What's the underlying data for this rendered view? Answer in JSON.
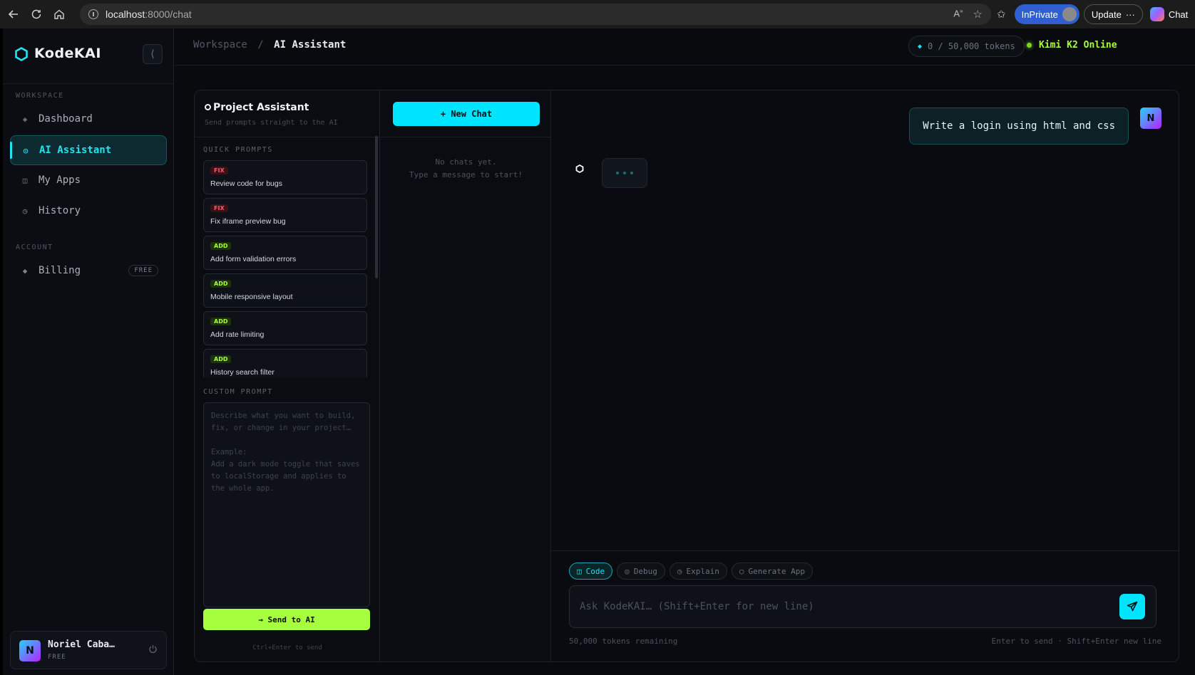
{
  "browser": {
    "url_host": "localhost",
    "url_path": ":8000/chat",
    "inprivate_label": "InPrivate",
    "update_label": "Update",
    "chat_label": "Chat"
  },
  "sidebar": {
    "brand": "KodeKAI",
    "collapse_glyph": "⟨",
    "workspace_label": "WORKSPACE",
    "account_label": "ACCOUNT",
    "items": [
      {
        "label": "Dashboard",
        "icon": "◈"
      },
      {
        "label": "AI Assistant",
        "icon": "◎"
      },
      {
        "label": "My Apps",
        "icon": "◫"
      },
      {
        "label": "History",
        "icon": "◷"
      }
    ],
    "billing": {
      "label": "Billing",
      "icon": "◆",
      "badge": "FREE"
    },
    "user": {
      "initial": "N",
      "name": "Noriel Caba…",
      "plan": "FREE"
    }
  },
  "topbar": {
    "crumb_root": "Workspace",
    "crumb_sep": "/",
    "crumb_current": "AI Assistant",
    "tokens": "0 / 50,000 tokens",
    "status": "Kimi K2 Online"
  },
  "prompts_panel": {
    "title": "Project Assistant",
    "subtitle": "Send prompts straight to the AI",
    "quick_label": "QUICK PROMPTS",
    "quick_prompts": [
      {
        "tag": "FIX",
        "text": "Review code for bugs"
      },
      {
        "tag": "FIX",
        "text": "Fix iframe preview bug"
      },
      {
        "tag": "ADD",
        "text": "Add form validation errors"
      },
      {
        "tag": "ADD",
        "text": "Mobile responsive layout"
      },
      {
        "tag": "ADD",
        "text": "Add rate limiting"
      },
      {
        "tag": "ADD",
        "text": "History search filter"
      }
    ],
    "custom_label": "CUSTOM PROMPT",
    "custom_placeholder": "Describe what you want to build, fix, or change in your project…\n\nExample:\nAdd a dark mode toggle that saves to localStorage and applies to the whole app.",
    "send_label": "→ Send to AI",
    "send_hint": "Ctrl+Enter to send"
  },
  "chats_panel": {
    "new_chat_label": "+ New Chat",
    "empty_line1": "No chats yet.",
    "empty_line2": "Type a message to start!"
  },
  "conversation": {
    "user_message": "Write a login using html and css",
    "user_initial": "N"
  },
  "composer": {
    "modes": [
      {
        "label": "Code",
        "icon": "◫"
      },
      {
        "label": "Debug",
        "icon": "◎"
      },
      {
        "label": "Explain",
        "icon": "◷"
      },
      {
        "label": "Generate App",
        "icon": "○"
      }
    ],
    "placeholder": "Ask KodeKAI… (Shift+Enter for new line)",
    "remaining": "50,000 tokens remaining",
    "hint": "Enter to send · Shift+Enter new line"
  },
  "colors": {
    "accent_cyan": "#00e5ff",
    "accent_lime": "#a6ff3f",
    "fix_red": "#ff5a6e",
    "bg": "#080a0e"
  }
}
